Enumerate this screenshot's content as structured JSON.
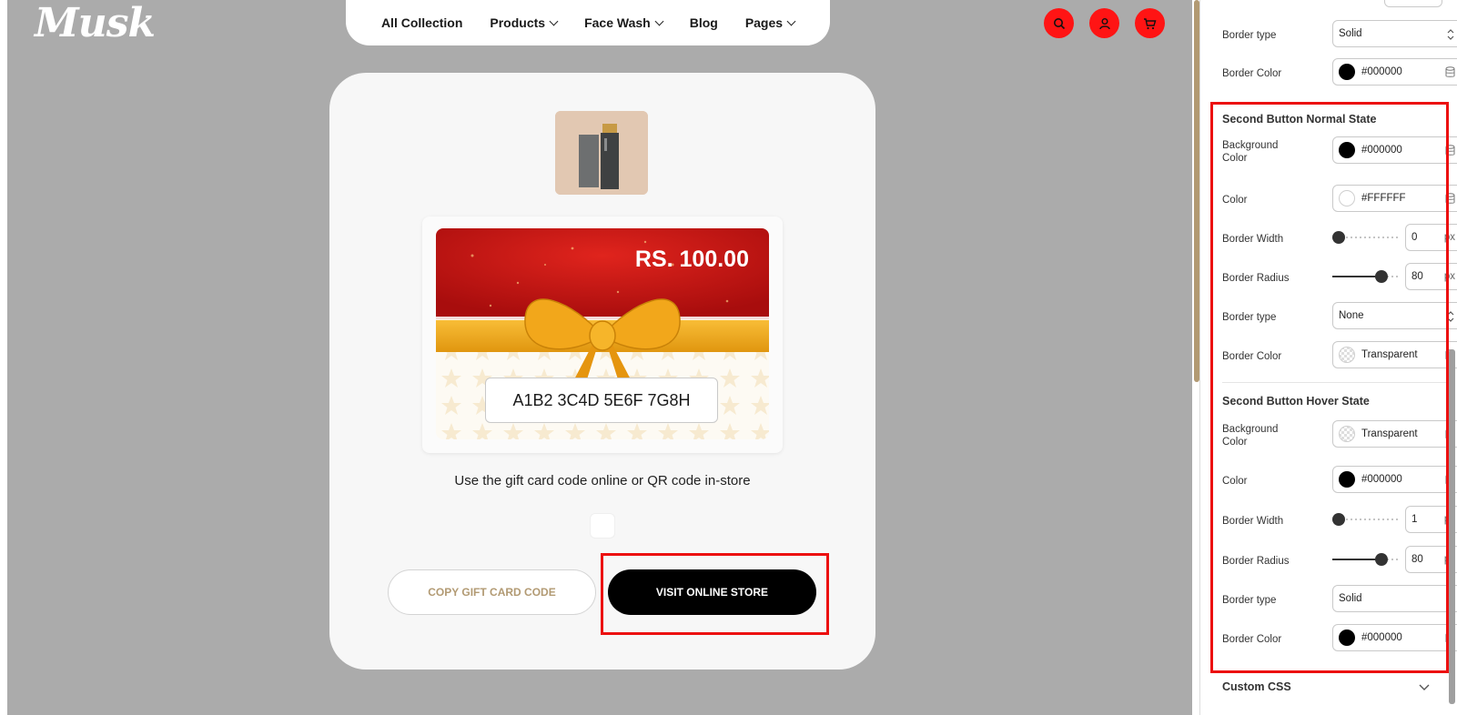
{
  "brand": {
    "logo": "Musk"
  },
  "nav": {
    "items": [
      {
        "label": "All Collection",
        "has_dropdown": false
      },
      {
        "label": "Products",
        "has_dropdown": true
      },
      {
        "label": "Face Wash",
        "has_dropdown": true
      },
      {
        "label": "Blog",
        "has_dropdown": false
      },
      {
        "label": "Pages",
        "has_dropdown": true
      }
    ],
    "icons": [
      "search-icon",
      "user-icon",
      "cart-icon"
    ],
    "icon_color": "#ff1414"
  },
  "gift_card": {
    "amount": "RS. 100.00",
    "code": "A1B2 3C4D 5E6F 7G8H",
    "hint": "Use the gift card code online or QR code in-store",
    "copy_button": "COPY GIFT CARD CODE",
    "visit_button": "VISIT ONLINE STORE"
  },
  "panel": {
    "top_rows": [
      {
        "label": "Border type",
        "type": "select",
        "value": "Solid"
      },
      {
        "label": "Border Color",
        "type": "color",
        "value": "#000000",
        "swatch": "black"
      }
    ],
    "normal_state": {
      "title": "Second Button Normal State",
      "background_label": "Background Color",
      "background_value": "#000000",
      "color_label": "Color",
      "color_value": "#FFFFFF",
      "border_width_label": "Border Width",
      "border_width_value": "0",
      "border_radius_label": "Border Radius",
      "border_radius_value": "80",
      "border_type_label": "Border type",
      "border_type_value": "None",
      "border_color_label": "Border Color",
      "border_color_value": "Transparent"
    },
    "hover_state": {
      "title": "Second Button Hover State",
      "background_label": "Background Color",
      "background_value": "Transparent",
      "color_label": "Color",
      "color_value": "#000000",
      "border_width_label": "Border Width",
      "border_width_value": "1",
      "border_radius_label": "Border Radius",
      "border_radius_value": "80",
      "border_type_label": "Border type",
      "border_type_value": "Solid",
      "border_color_label": "Border Color",
      "border_color_value": "#000000"
    },
    "unit": "px",
    "custom_css_label": "Custom CSS"
  },
  "colors": {
    "highlight": "#ec1010",
    "accent_gold": "#b29a73"
  }
}
